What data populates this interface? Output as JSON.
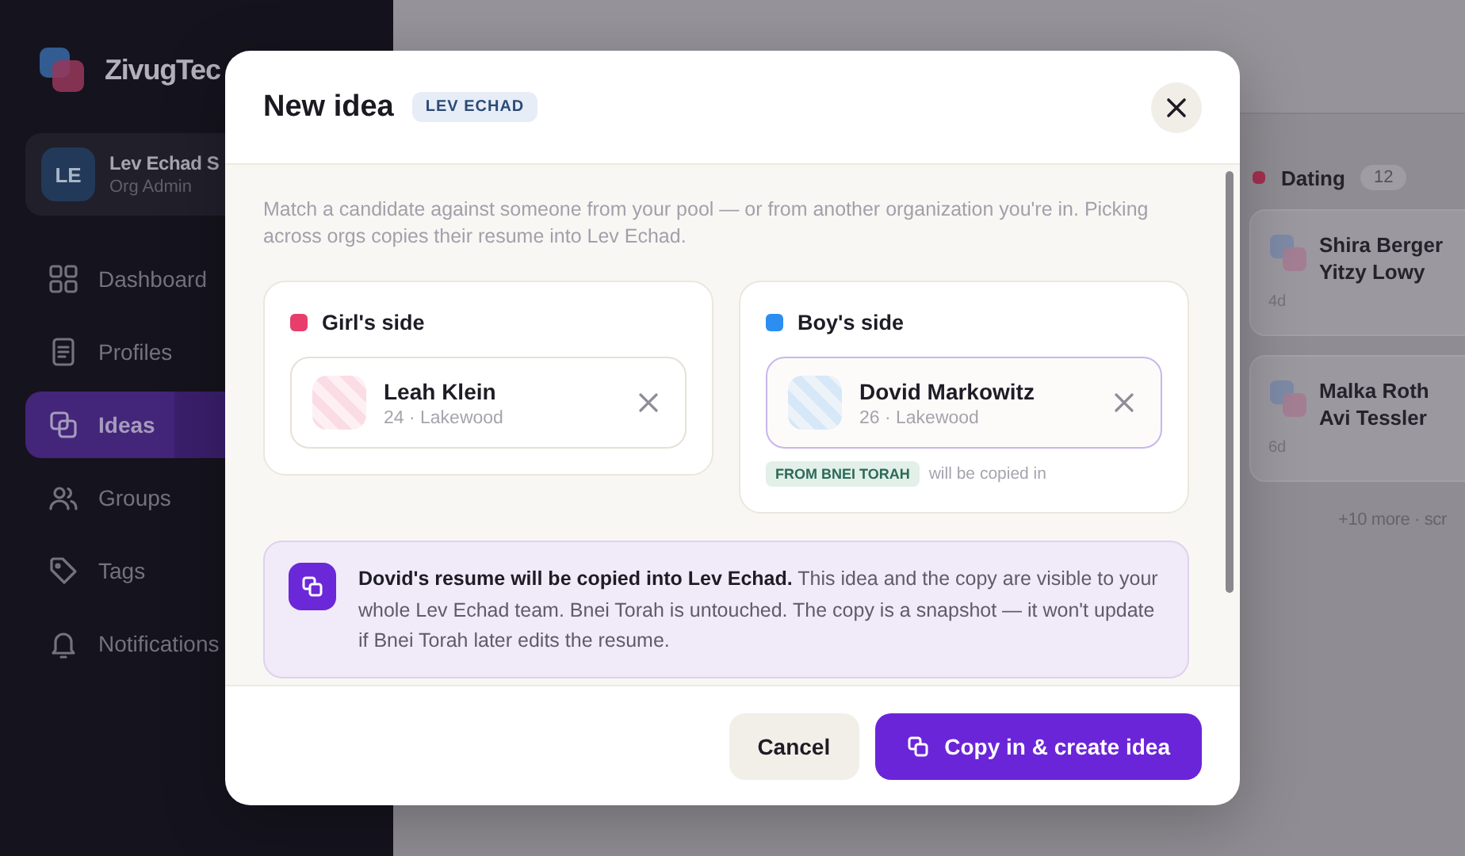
{
  "sidebar": {
    "logo": "ZivugTec",
    "account": {
      "initials": "LE",
      "name": "Lev Echad S",
      "role": "Org Admin"
    },
    "nav": [
      {
        "label": "Dashboard",
        "selected": false
      },
      {
        "label": "Profiles",
        "selected": false
      },
      {
        "label": "Ideas",
        "selected": true
      },
      {
        "label": "Groups",
        "selected": false
      },
      {
        "label": "Tags",
        "selected": false
      },
      {
        "label": "Notifications",
        "selected": false
      }
    ]
  },
  "page": {
    "column": {
      "name": "Dating",
      "color": "#a3304f",
      "count": "12",
      "cards": [
        {
          "names": [
            "Shira Berger",
            "Yitzy Lowy"
          ],
          "age": "4d"
        },
        {
          "names": [
            "Malka Roth",
            "Avi Tessler"
          ],
          "age": "6d"
        }
      ],
      "more": "+10 more · scr"
    }
  },
  "dialog": {
    "title": "New idea",
    "org_badge": "LEV ECHAD",
    "intro": "Match a candidate against someone from your pool — or from another organization you're in. Picking across orgs copies their resume into Lev Echad.",
    "sides": [
      {
        "label": "Girl's side",
        "color": "#e83e6c",
        "candidate": {
          "name": "Leah Klein",
          "details": "24 · Lakewood"
        }
      },
      {
        "label": "Boy's side",
        "color": "#2b8ef0",
        "candidate": {
          "name": "Dovid Markowitz",
          "details": "26 · Lakewood"
        },
        "source": {
          "tag": "FROM BNEI TORAH",
          "note": "will be copied in"
        }
      }
    ],
    "notice": "**Dovid's resume will be copied into Lev Echad.** This idea and the copy are visible to your whole Lev Echad team. Bnei Torah is untouched. The copy is a snapshot — it won't update if Bnei Torah later edits the resume.",
    "buttons": [
      {
        "label": "Cancel",
        "kind": "secondary"
      },
      {
        "label": "Copy in & create idea",
        "kind": "primary"
      }
    ]
  }
}
